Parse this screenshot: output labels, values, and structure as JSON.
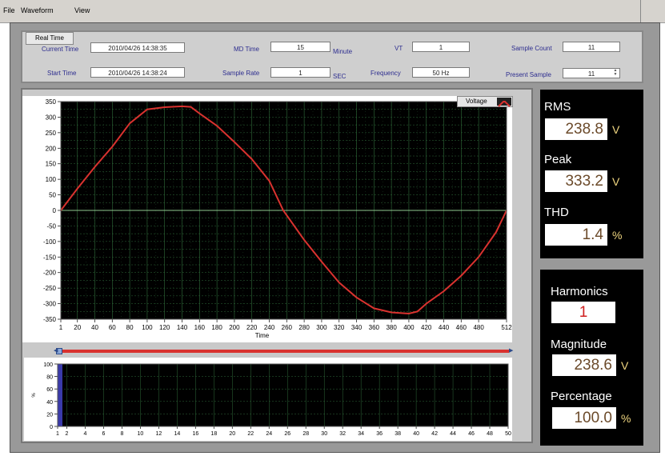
{
  "menu": {
    "file": "File",
    "waveform": "Waveform",
    "view": "View"
  },
  "header": {
    "tab": "Real Time",
    "current_time": {
      "label": "Current Time",
      "value": "2010/04/26 14:38:35"
    },
    "start_time": {
      "label": "Start Time",
      "value": "2010/04/26 14:38:24"
    },
    "md_time": {
      "label": "MD Time",
      "value": "15",
      "unit": "Minute"
    },
    "sample_rate": {
      "label": "Sample Rate",
      "value": "1",
      "unit": "SEC"
    },
    "vt": {
      "label": "VT",
      "value": "1"
    },
    "frequency": {
      "label": "Frequency",
      "value": "50 Hz"
    },
    "sample_count": {
      "label": "Sample Count",
      "value": "11"
    },
    "present_sample": {
      "label": "Present Sample",
      "value": "11"
    }
  },
  "measurements": {
    "rms": {
      "label": "RMS",
      "value": "238.8",
      "unit": "V"
    },
    "peak": {
      "label": "Peak",
      "value": "333.2",
      "unit": "V"
    },
    "thd": {
      "label": "THD",
      "value": "1.4",
      "unit": "%"
    }
  },
  "harmonics": {
    "harmonics": {
      "label": "Harmonics",
      "value": "1"
    },
    "magnitude": {
      "label": "Magnitude",
      "value": "238.6",
      "unit": "V"
    },
    "percentage": {
      "label": "Percentage",
      "value": "100.0",
      "unit": "%"
    }
  },
  "colors": {
    "plot_bg": "#000000",
    "grid": "#2f6a3a",
    "trace": "#d9322f",
    "harmonic_bar": "#3a3aaa",
    "value_text": "#6b4a2a",
    "harmonic_value_text": "#d02020"
  },
  "chart_data": [
    {
      "type": "line",
      "series": [
        {
          "name": "Voltage",
          "x": [
            1,
            20,
            40,
            60,
            80,
            100,
            120,
            140,
            150,
            160,
            180,
            200,
            220,
            240,
            256,
            280,
            300,
            320,
            340,
            360,
            380,
            400,
            410,
            420,
            440,
            460,
            480,
            500,
            512
          ],
          "y": [
            0,
            70,
            140,
            205,
            280,
            325,
            332,
            335,
            333,
            312,
            272,
            220,
            165,
            95,
            0,
            -95,
            -165,
            -232,
            -280,
            -315,
            -328,
            -332,
            -325,
            -300,
            -260,
            -210,
            -150,
            -70,
            0
          ]
        }
      ],
      "xlabel": "Time",
      "ylabel": "",
      "xlim": [
        1,
        512
      ],
      "ylim": [
        -350,
        350
      ],
      "x_ticks": [
        "1",
        "20",
        "40",
        "60",
        "80",
        "100",
        "120",
        "140",
        "160",
        "180",
        "200",
        "220",
        "240",
        "260",
        "280",
        "300",
        "320",
        "340",
        "360",
        "380",
        "400",
        "420",
        "440",
        "460",
        "480",
        "512"
      ],
      "y_ticks": [
        "350",
        "300",
        "250",
        "200",
        "150",
        "100",
        "50",
        "0",
        "-50",
        "-100",
        "-150",
        "-200",
        "-250",
        "-300",
        "-350"
      ],
      "legend": "top-right",
      "grid": true
    },
    {
      "type": "bar",
      "categories": [
        1
      ],
      "values": [
        100
      ],
      "ylabel": "%",
      "xlim": [
        1,
        50
      ],
      "ylim": [
        0,
        100
      ],
      "x_ticks": [
        "1",
        "2",
        "4",
        "6",
        "8",
        "10",
        "12",
        "14",
        "16",
        "18",
        "20",
        "22",
        "24",
        "26",
        "28",
        "30",
        "32",
        "34",
        "36",
        "38",
        "40",
        "42",
        "44",
        "46",
        "48",
        "50"
      ],
      "y_ticks": [
        "100",
        "80",
        "60",
        "40",
        "20",
        "0"
      ],
      "grid": true
    }
  ]
}
